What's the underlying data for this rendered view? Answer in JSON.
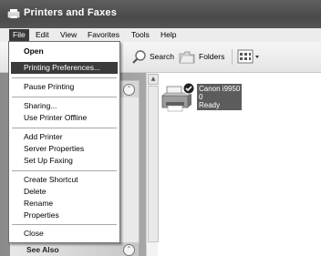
{
  "window": {
    "title": "Printers and Faxes"
  },
  "menubar": {
    "items": [
      "File",
      "Edit",
      "View",
      "Favorites",
      "Tools",
      "Help"
    ],
    "active": "File"
  },
  "toolbar": {
    "search_label": "Search",
    "folders_label": "Folders",
    "views_icon": "views-icon"
  },
  "file_menu": {
    "groups": [
      [
        "Open",
        "Printing Preferences..."
      ],
      [
        "Pause Printing"
      ],
      [
        "Sharing...",
        "Use Printer Offline"
      ],
      [
        "Add Printer",
        "Server Properties",
        "Set Up Faxing"
      ],
      [
        "Create Shortcut",
        "Delete",
        "Rename",
        "Properties"
      ],
      [
        "Close"
      ]
    ],
    "default_item": "Open",
    "highlighted_item": "Printing Preferences..."
  },
  "task_pane": {
    "see_also_label": "See Also"
  },
  "printers": [
    {
      "name": "Canon i9950",
      "documents": "0",
      "status": "Ready",
      "is_default": true
    }
  ],
  "colors": {
    "title_bar": "#4f4f4f",
    "highlight": "#3a3a3a",
    "menu_bg": "#ececec"
  }
}
